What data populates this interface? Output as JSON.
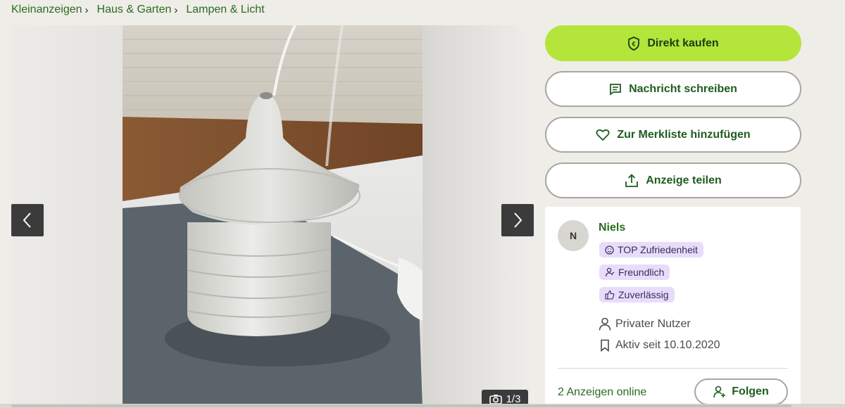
{
  "breadcrumb": [
    {
      "label": "Kleinanzeigen"
    },
    {
      "label": "Haus & Garten"
    },
    {
      "label": "Lampen & Licht"
    }
  ],
  "gallery": {
    "counter": "1/3",
    "icons": {
      "prev": "chevron-left-icon",
      "next": "chevron-right-icon",
      "camera": "camera-icon"
    }
  },
  "actions": {
    "buy": "Direkt kaufen",
    "message": "Nachricht schreiben",
    "watchlist": "Zur Merkliste hinzufügen",
    "share": "Anzeige teilen"
  },
  "seller": {
    "initial": "N",
    "name": "Niels",
    "badges": [
      "TOP Zufriedenheit",
      "Freundlich",
      "Zuverlässig"
    ],
    "type": "Privater Nutzer",
    "active_since": "Aktiv seit 10.10.2020",
    "ads_online": "2 Anzeigen online",
    "follow": "Folgen"
  },
  "colors": {
    "accent": "#b3e53b",
    "link": "#2a6b1f",
    "badge_bg": "#e8dcfa",
    "page_bg": "#efede8"
  }
}
